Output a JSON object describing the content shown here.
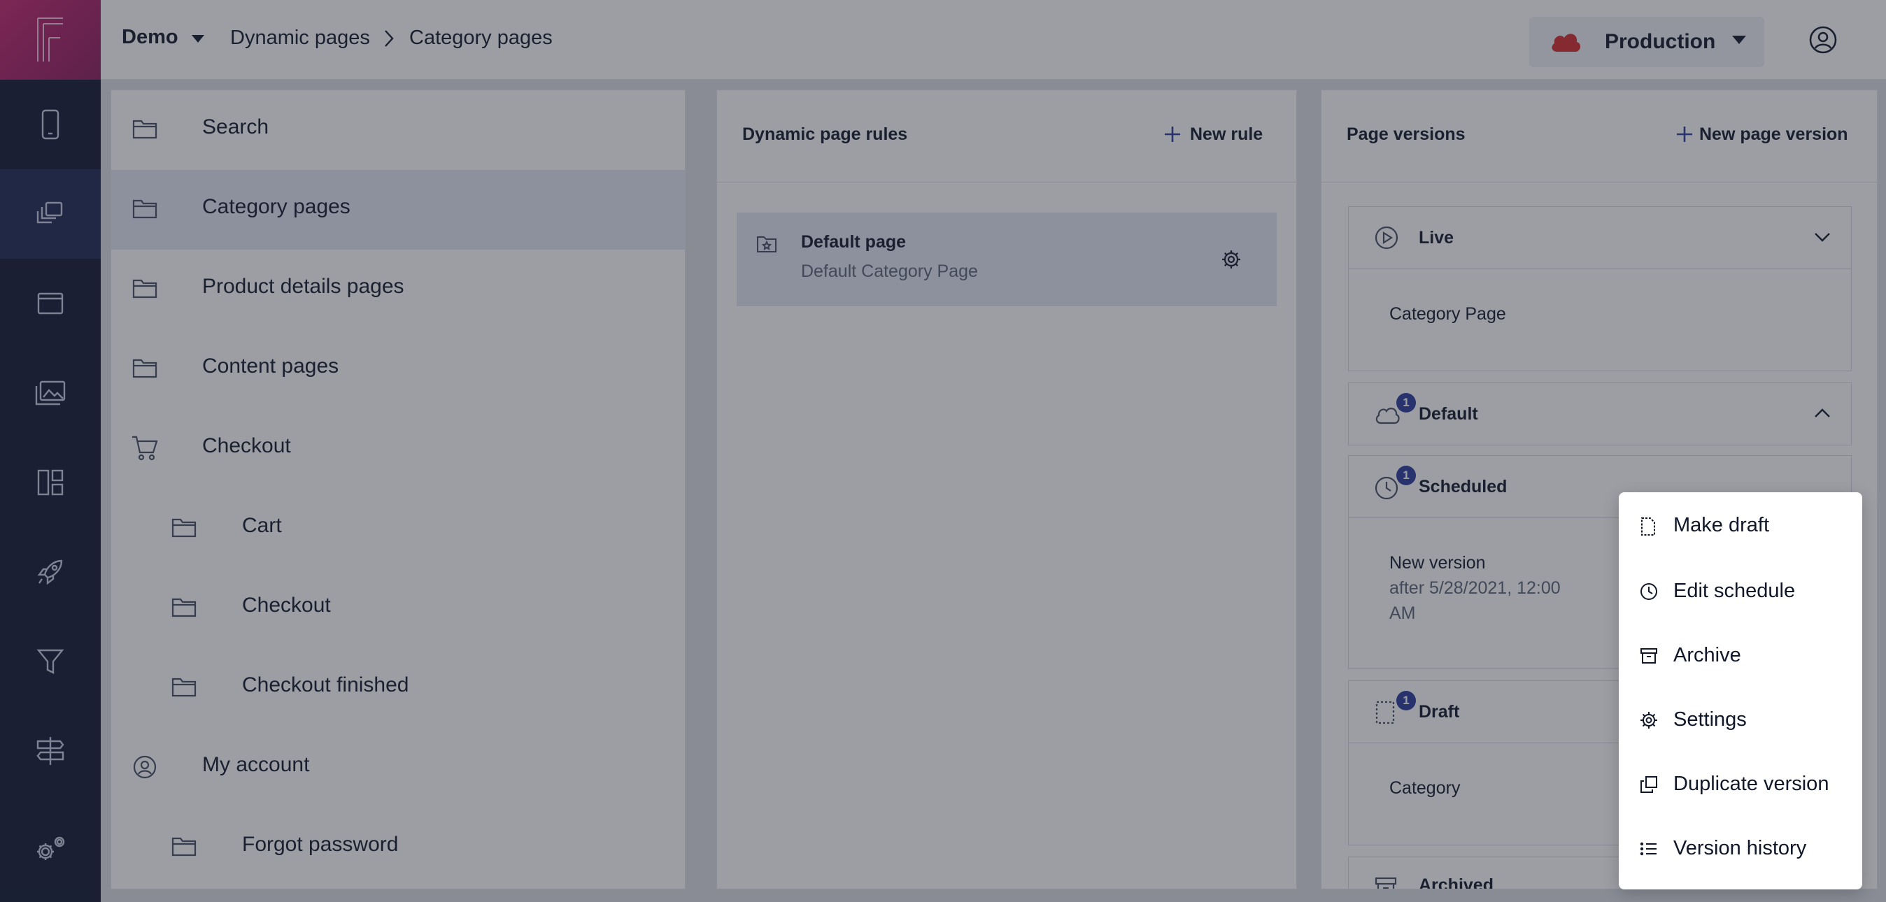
{
  "header": {
    "project": "Demo",
    "breadcrumb": [
      "Dynamic pages",
      "Category pages"
    ],
    "environment": "Production"
  },
  "rail": {
    "icons": [
      "logo-icon",
      "mobile-icon",
      "pages-icon",
      "window-icon",
      "media-icon",
      "layout-icon",
      "rocket-icon",
      "filter-icon",
      "signpost-icon",
      "settings-icon"
    ],
    "active": "pages-icon"
  },
  "tree": {
    "items": [
      {
        "label": "Search",
        "icon": "folder-icon",
        "indent": 0
      },
      {
        "label": "Category pages",
        "icon": "folder-icon",
        "indent": 0,
        "selected": true
      },
      {
        "label": "Product details pages",
        "icon": "folder-icon",
        "indent": 0
      },
      {
        "label": "Content pages",
        "icon": "folder-icon",
        "indent": 0
      },
      {
        "label": "Checkout",
        "icon": "cart-icon",
        "indent": 0
      },
      {
        "label": "Cart",
        "icon": "folder-icon",
        "indent": 1
      },
      {
        "label": "Checkout",
        "icon": "folder-icon",
        "indent": 1
      },
      {
        "label": "Checkout finished",
        "icon": "folder-icon",
        "indent": 1
      },
      {
        "label": "My account",
        "icon": "user-circle-icon",
        "indent": 0
      },
      {
        "label": "Forgot password",
        "icon": "folder-icon",
        "indent": 1
      }
    ]
  },
  "rules": {
    "title": "Dynamic page rules",
    "new_label": "New rule",
    "card": {
      "title": "Default page",
      "subtitle": "Default Category Page"
    }
  },
  "versions": {
    "title": "Page versions",
    "new_label": "New page version",
    "groups": {
      "live": {
        "label": "Live",
        "item": "Category Page"
      },
      "default": {
        "label": "Default",
        "badge": "1"
      },
      "scheduled": {
        "label": "Scheduled",
        "badge": "1",
        "item": "New version",
        "sub1": "after 5/28/2021, 12:00",
        "sub2": "AM"
      },
      "draft": {
        "label": "Draft",
        "badge": "1",
        "item": "Category"
      },
      "archived": {
        "label": "Archived"
      }
    }
  },
  "menu": {
    "items": [
      "Make draft",
      "Edit schedule",
      "Archive",
      "Settings",
      "Duplicate version",
      "Version history"
    ]
  },
  "colors": {
    "rail": "#0f1630",
    "logo": "#c4246e",
    "badge": "#2a3a9a",
    "cloud": "#d42a2a"
  }
}
